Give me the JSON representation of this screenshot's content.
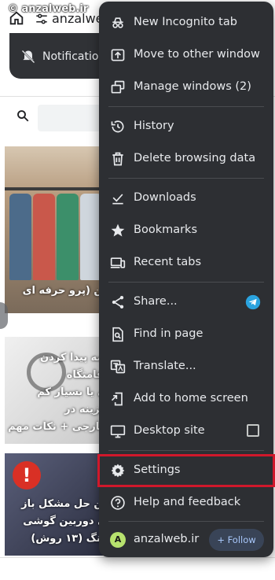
{
  "watermark": "© anzalweb.ir",
  "topbar": {
    "url": "anzalweb"
  },
  "notification": {
    "label": "Notification"
  },
  "articles": [
    {
      "title": "بن (پرو حرفه ای"
    },
    {
      "title": "امه پیدا کردن اقامتگاه\nی یا بسیار کم هزینه در\nخارجی + نکات مهم"
    },
    {
      "title": "ین حل مشکل باز\nی دوربین گوشی\nونگ (۱۳ روش)"
    }
  ],
  "menu": {
    "items": [
      {
        "label": "New Incognito tab"
      },
      {
        "label": "Move to other window"
      },
      {
        "label": "Manage windows (2)"
      },
      {
        "label": "History"
      },
      {
        "label": "Delete browsing data"
      },
      {
        "label": "Downloads"
      },
      {
        "label": "Bookmarks"
      },
      {
        "label": "Recent tabs"
      },
      {
        "label": "Share..."
      },
      {
        "label": "Find in page"
      },
      {
        "label": "Translate..."
      },
      {
        "label": "Add to home screen"
      },
      {
        "label": "Desktop site"
      },
      {
        "label": "Settings"
      },
      {
        "label": "Help and feedback"
      }
    ],
    "account": {
      "initial": "A",
      "name": "anzalweb.ir",
      "follow_label": "+ Follow"
    }
  },
  "colors": {
    "menu_bg": "#2d2f33",
    "highlight": "#d0182b",
    "accent": "#a8c7fa"
  }
}
